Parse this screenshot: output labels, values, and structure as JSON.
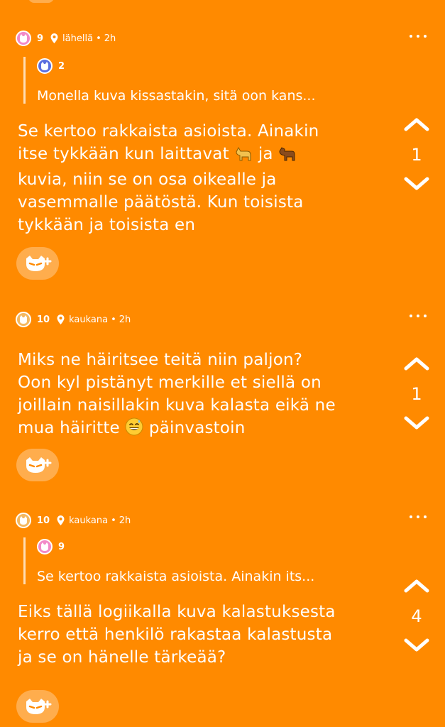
{
  "posts": [
    {
      "karma": "9",
      "location": "lähellä",
      "time": "2h",
      "avatar_color": "#f28ac8",
      "quote": {
        "karma": "2",
        "avatar_color": "#5b6fe0",
        "text": "Monella kuva kissastakin, sitä oon kans..."
      },
      "body_lines": [
        "Se kertoo rakkaista asioista. Ainakin",
        "itse tykkään kun laittavat",
        "ja",
        "kuvia, niin se on osa oikealle ja",
        "vasemmalle päätöstä. Kun toisista",
        "tykkään ja toisista en"
      ],
      "votes": "1"
    },
    {
      "karma": "10",
      "location": "kaukana",
      "time": "2h",
      "avatar_color": "#f4b860",
      "body_lines": [
        "Miks ne häiritsee teitä niin paljon?",
        "Oon kyl pistänyt merkille et siellä on",
        "joillain naisillakin kuva kalasta eikä ne",
        "mua häiritte",
        "päinvastoin"
      ],
      "votes": "1"
    },
    {
      "karma": "10",
      "location": "kaukana",
      "time": "2h",
      "avatar_color": "#f4b860",
      "quote": {
        "karma": "9",
        "avatar_color": "#f28ac8",
        "text": "Se kertoo rakkaista asioista. Ainakin its..."
      },
      "body_lines": [
        "Eiks tällä logiikalla kuva kalastuksesta",
        "kerro että henkilö rakastaa kalastusta",
        "ja se on hänelle tärkeää?"
      ],
      "votes": "4"
    }
  ],
  "icons": {
    "pin": "location-pin-icon",
    "more": "more-dots-icon",
    "up": "chevron-up-icon",
    "down": "chevron-down-icon",
    "react": "add-reaction-icon"
  },
  "colors": {
    "background": "#ff8a00",
    "text": "#ffffff"
  }
}
